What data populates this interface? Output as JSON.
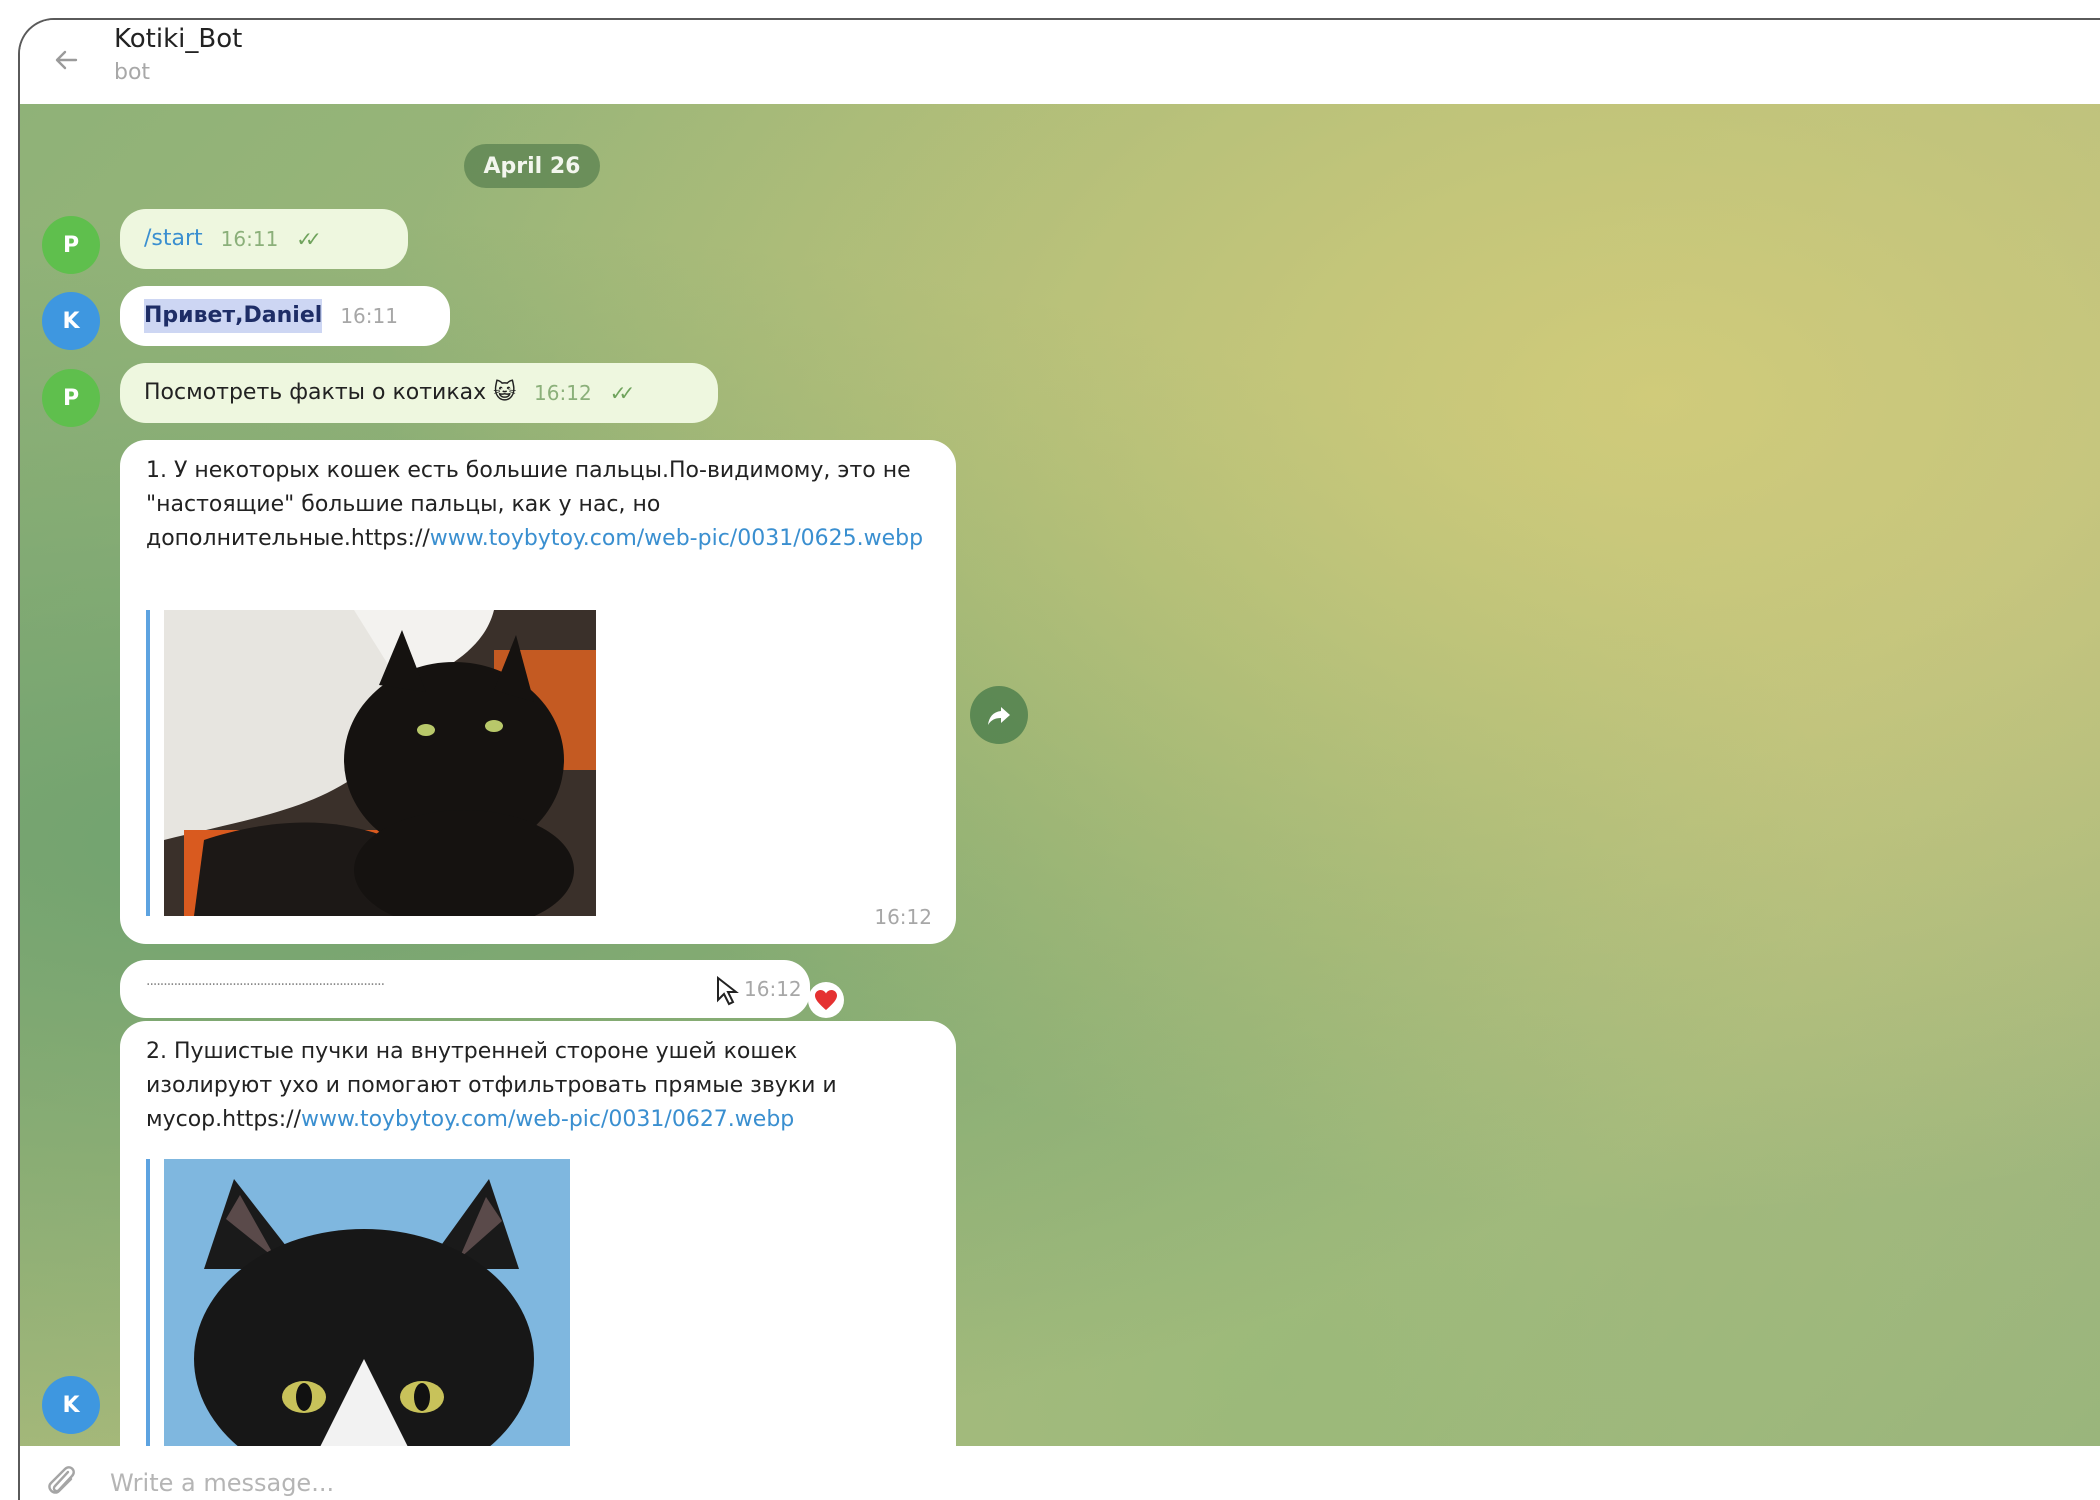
{
  "header": {
    "title": "Kotiki_Bot",
    "subtitle": "bot"
  },
  "chat": {
    "date": "April 26",
    "messages": [
      {
        "avatar": "P",
        "text": "/start",
        "time": "16:11"
      },
      {
        "avatar": "K",
        "text": "Привет,Daniel",
        "time": "16:11"
      },
      {
        "avatar": "P",
        "text": "Посмотреть факты о котиках",
        "emoji": "😺",
        "time": "16:12"
      },
      {
        "text": "1. У некоторых кошек есть большие пальцы.По-видимому, это не \"настоящие\" большие пальцы, как у нас, но дополнительные.",
        "link_prefix": "https://",
        "link": "www.toybytoy.com/web-pic/0031/0625.webp",
        "time": "16:12"
      },
      {
        "text": "·····································································",
        "time": "16:12"
      },
      {
        "text": "2. Пушистые пучки на внутренней стороне ушей кошек изолируют ухо и помогают отфильтровать прямые звуки и мусор.",
        "link_prefix": "https://",
        "link": "www.toybytoy.com/web-pic/0031/0627.webp"
      },
      {
        "avatar": "K"
      }
    ]
  },
  "composer": {
    "placeholder": "Write a message..."
  }
}
